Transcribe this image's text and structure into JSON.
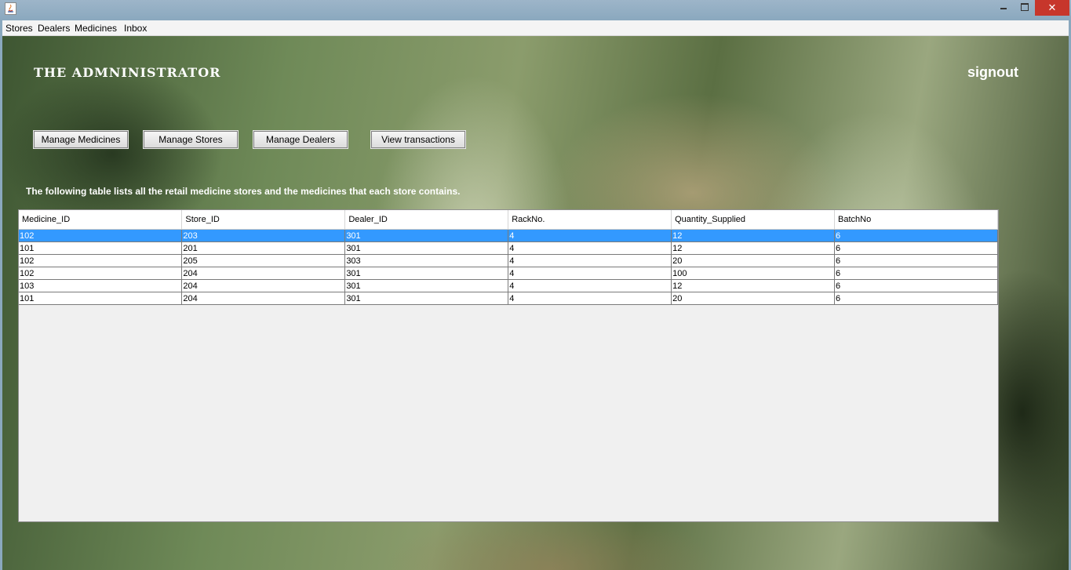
{
  "window": {
    "title": "",
    "close_glyph": "✕"
  },
  "menubar": [
    "Stores",
    "Dealers",
    "Medicines",
    "Inbox"
  ],
  "header": {
    "title": "THE ADMNINISTRATOR",
    "signout": "signout"
  },
  "buttons": {
    "manage_medicines": "Manage Medicines",
    "manage_stores": "Manage Stores",
    "manage_dealers": "Manage Dealers",
    "view_transactions": "View transactions"
  },
  "description": "The following table lists all the retail medicine stores and the medicines that each store contains.",
  "table": {
    "columns": [
      "Medicine_ID",
      "Store_ID",
      "Dealer_ID",
      "RackNo.",
      "Quantity_Supplied",
      "BatchNo"
    ],
    "rows": [
      [
        "102",
        "203",
        "301",
        "4",
        "12",
        "6"
      ],
      [
        "101",
        "201",
        "301",
        "4",
        "12",
        "6"
      ],
      [
        "102",
        "205",
        "303",
        "4",
        "20",
        "6"
      ],
      [
        "102",
        "204",
        "301",
        "4",
        "100",
        "6"
      ],
      [
        "103",
        "204",
        "301",
        "4",
        "12",
        "6"
      ],
      [
        "101",
        "204",
        "301",
        "4",
        "20",
        "6"
      ]
    ],
    "selected_row": 0,
    "selection_color": "#3399ff"
  }
}
